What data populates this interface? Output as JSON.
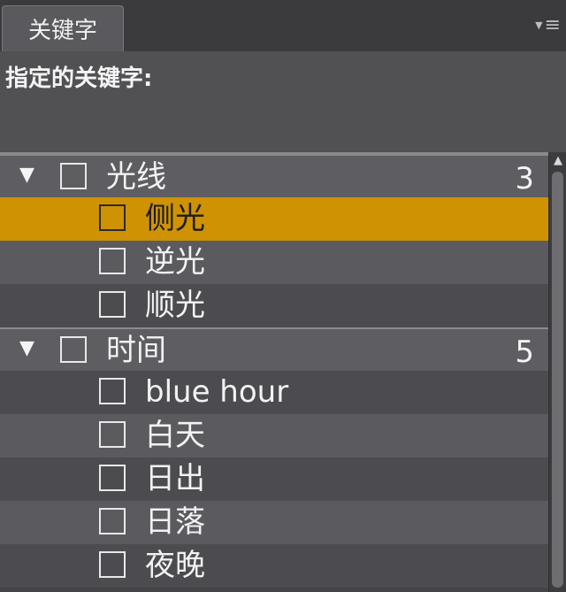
{
  "panel": {
    "tab_label": "关键字",
    "menu_icon": "panel-menu-icon"
  },
  "assigned": {
    "label": "指定的关键字:"
  },
  "keywords": [
    {
      "name": "光线",
      "count": "3",
      "expanded": true,
      "children": [
        {
          "name": "侧光",
          "selected": true
        },
        {
          "name": "逆光",
          "selected": false
        },
        {
          "name": "顺光",
          "selected": false
        }
      ]
    },
    {
      "name": "时间",
      "count": "5",
      "expanded": true,
      "children": [
        {
          "name": "blue hour",
          "selected": false
        },
        {
          "name": "白天",
          "selected": false
        },
        {
          "name": "日出",
          "selected": false
        },
        {
          "name": "日落",
          "selected": false
        },
        {
          "name": "夜晚",
          "selected": false
        }
      ]
    }
  ],
  "colors": {
    "selection": "#cf9203",
    "panel_bg": "#4a4a4d"
  }
}
